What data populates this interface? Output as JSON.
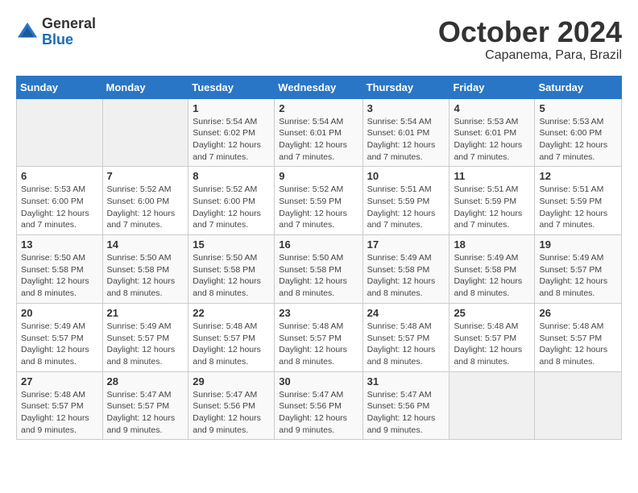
{
  "header": {
    "logo": {
      "general": "General",
      "blue": "Blue"
    },
    "title": "October 2024",
    "location": "Capanema, Para, Brazil"
  },
  "days_of_week": [
    "Sunday",
    "Monday",
    "Tuesday",
    "Wednesday",
    "Thursday",
    "Friday",
    "Saturday"
  ],
  "weeks": [
    [
      {
        "day": "",
        "empty": true
      },
      {
        "day": "",
        "empty": true
      },
      {
        "day": "1",
        "sunrise": "Sunrise: 5:54 AM",
        "sunset": "Sunset: 6:02 PM",
        "daylight": "Daylight: 12 hours and 7 minutes."
      },
      {
        "day": "2",
        "sunrise": "Sunrise: 5:54 AM",
        "sunset": "Sunset: 6:01 PM",
        "daylight": "Daylight: 12 hours and 7 minutes."
      },
      {
        "day": "3",
        "sunrise": "Sunrise: 5:54 AM",
        "sunset": "Sunset: 6:01 PM",
        "daylight": "Daylight: 12 hours and 7 minutes."
      },
      {
        "day": "4",
        "sunrise": "Sunrise: 5:53 AM",
        "sunset": "Sunset: 6:01 PM",
        "daylight": "Daylight: 12 hours and 7 minutes."
      },
      {
        "day": "5",
        "sunrise": "Sunrise: 5:53 AM",
        "sunset": "Sunset: 6:00 PM",
        "daylight": "Daylight: 12 hours and 7 minutes."
      }
    ],
    [
      {
        "day": "6",
        "sunrise": "Sunrise: 5:53 AM",
        "sunset": "Sunset: 6:00 PM",
        "daylight": "Daylight: 12 hours and 7 minutes."
      },
      {
        "day": "7",
        "sunrise": "Sunrise: 5:52 AM",
        "sunset": "Sunset: 6:00 PM",
        "daylight": "Daylight: 12 hours and 7 minutes."
      },
      {
        "day": "8",
        "sunrise": "Sunrise: 5:52 AM",
        "sunset": "Sunset: 6:00 PM",
        "daylight": "Daylight: 12 hours and 7 minutes."
      },
      {
        "day": "9",
        "sunrise": "Sunrise: 5:52 AM",
        "sunset": "Sunset: 5:59 PM",
        "daylight": "Daylight: 12 hours and 7 minutes."
      },
      {
        "day": "10",
        "sunrise": "Sunrise: 5:51 AM",
        "sunset": "Sunset: 5:59 PM",
        "daylight": "Daylight: 12 hours and 7 minutes."
      },
      {
        "day": "11",
        "sunrise": "Sunrise: 5:51 AM",
        "sunset": "Sunset: 5:59 PM",
        "daylight": "Daylight: 12 hours and 7 minutes."
      },
      {
        "day": "12",
        "sunrise": "Sunrise: 5:51 AM",
        "sunset": "Sunset: 5:59 PM",
        "daylight": "Daylight: 12 hours and 7 minutes."
      }
    ],
    [
      {
        "day": "13",
        "sunrise": "Sunrise: 5:50 AM",
        "sunset": "Sunset: 5:58 PM",
        "daylight": "Daylight: 12 hours and 8 minutes."
      },
      {
        "day": "14",
        "sunrise": "Sunrise: 5:50 AM",
        "sunset": "Sunset: 5:58 PM",
        "daylight": "Daylight: 12 hours and 8 minutes."
      },
      {
        "day": "15",
        "sunrise": "Sunrise: 5:50 AM",
        "sunset": "Sunset: 5:58 PM",
        "daylight": "Daylight: 12 hours and 8 minutes."
      },
      {
        "day": "16",
        "sunrise": "Sunrise: 5:50 AM",
        "sunset": "Sunset: 5:58 PM",
        "daylight": "Daylight: 12 hours and 8 minutes."
      },
      {
        "day": "17",
        "sunrise": "Sunrise: 5:49 AM",
        "sunset": "Sunset: 5:58 PM",
        "daylight": "Daylight: 12 hours and 8 minutes."
      },
      {
        "day": "18",
        "sunrise": "Sunrise: 5:49 AM",
        "sunset": "Sunset: 5:58 PM",
        "daylight": "Daylight: 12 hours and 8 minutes."
      },
      {
        "day": "19",
        "sunrise": "Sunrise: 5:49 AM",
        "sunset": "Sunset: 5:57 PM",
        "daylight": "Daylight: 12 hours and 8 minutes."
      }
    ],
    [
      {
        "day": "20",
        "sunrise": "Sunrise: 5:49 AM",
        "sunset": "Sunset: 5:57 PM",
        "daylight": "Daylight: 12 hours and 8 minutes."
      },
      {
        "day": "21",
        "sunrise": "Sunrise: 5:49 AM",
        "sunset": "Sunset: 5:57 PM",
        "daylight": "Daylight: 12 hours and 8 minutes."
      },
      {
        "day": "22",
        "sunrise": "Sunrise: 5:48 AM",
        "sunset": "Sunset: 5:57 PM",
        "daylight": "Daylight: 12 hours and 8 minutes."
      },
      {
        "day": "23",
        "sunrise": "Sunrise: 5:48 AM",
        "sunset": "Sunset: 5:57 PM",
        "daylight": "Daylight: 12 hours and 8 minutes."
      },
      {
        "day": "24",
        "sunrise": "Sunrise: 5:48 AM",
        "sunset": "Sunset: 5:57 PM",
        "daylight": "Daylight: 12 hours and 8 minutes."
      },
      {
        "day": "25",
        "sunrise": "Sunrise: 5:48 AM",
        "sunset": "Sunset: 5:57 PM",
        "daylight": "Daylight: 12 hours and 8 minutes."
      },
      {
        "day": "26",
        "sunrise": "Sunrise: 5:48 AM",
        "sunset": "Sunset: 5:57 PM",
        "daylight": "Daylight: 12 hours and 8 minutes."
      }
    ],
    [
      {
        "day": "27",
        "sunrise": "Sunrise: 5:48 AM",
        "sunset": "Sunset: 5:57 PM",
        "daylight": "Daylight: 12 hours and 9 minutes."
      },
      {
        "day": "28",
        "sunrise": "Sunrise: 5:47 AM",
        "sunset": "Sunset: 5:57 PM",
        "daylight": "Daylight: 12 hours and 9 minutes."
      },
      {
        "day": "29",
        "sunrise": "Sunrise: 5:47 AM",
        "sunset": "Sunset: 5:56 PM",
        "daylight": "Daylight: 12 hours and 9 minutes."
      },
      {
        "day": "30",
        "sunrise": "Sunrise: 5:47 AM",
        "sunset": "Sunset: 5:56 PM",
        "daylight": "Daylight: 12 hours and 9 minutes."
      },
      {
        "day": "31",
        "sunrise": "Sunrise: 5:47 AM",
        "sunset": "Sunset: 5:56 PM",
        "daylight": "Daylight: 12 hours and 9 minutes."
      },
      {
        "day": "",
        "empty": true
      },
      {
        "day": "",
        "empty": true
      }
    ]
  ]
}
